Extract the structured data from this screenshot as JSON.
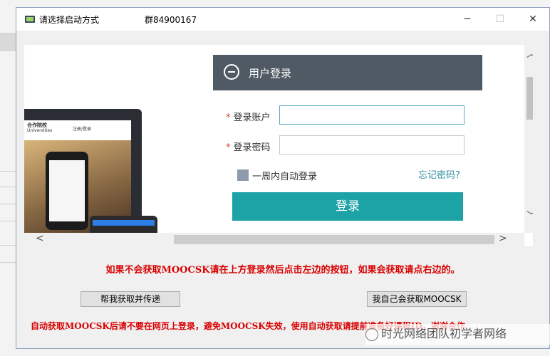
{
  "window": {
    "title": "请选择启动方式",
    "group": "群84900167"
  },
  "login": {
    "header": "用户登录",
    "account_label": "登录账户",
    "password_label": "登录密码",
    "required_mark": "*",
    "remember_label": "一周内自动登录",
    "forgot_link": "忘记密码?",
    "submit": "登录"
  },
  "preview": {
    "site_name": "合作院校",
    "site_sub": "Universities",
    "nav": "注册/登录"
  },
  "instruction": "如果不会获取MOOCSK请在上方登录然后点击左边的按钮，如果会获取请点右边的。",
  "buttons": {
    "left": "帮我获取并传递",
    "right": "我自己会获取MOOCSK"
  },
  "bottom_notice": "自动获取MOOCSK后请不要在网页上登录，避免MOOCSK失效，使用自动获取请提前准备好课程ID，谢谢合作",
  "watermark": "时光网络团队初学者网络"
}
